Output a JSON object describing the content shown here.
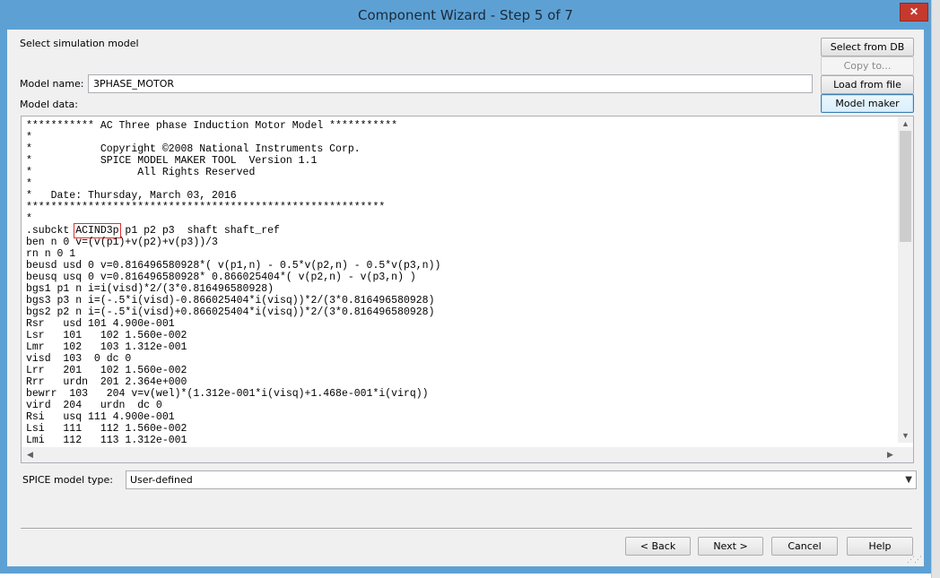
{
  "window": {
    "title": "Component Wizard - Step 5 of 7",
    "close_glyph": "✕"
  },
  "header": {
    "section_label": "Select simulation model"
  },
  "side_buttons": {
    "select_from_db": "Select from DB",
    "copy_to": "Copy to...",
    "load_from_file": "Load from file",
    "model_maker": "Model maker"
  },
  "model": {
    "name_label": "Model name:",
    "name_value": "3PHASE_MOTOR",
    "data_label": "Model data:",
    "highlighted_token": "ACIND3p",
    "lines": [
      "*********** AC Three phase Induction Motor Model ***********",
      "*",
      "*           Copyright ©2008 National Instruments Corp.",
      "*           SPICE MODEL MAKER TOOL  Version 1.1",
      "*                 All Rights Reserved",
      "*",
      "*   Date: Thursday, March 03, 2016",
      "**********************************************************",
      "*",
      ".subckt ACIND3p p1 p2 p3  shaft shaft_ref",
      "ben n 0 v=(v(p1)+v(p2)+v(p3))/3",
      "rn n 0 1",
      "beusd usd 0 v=0.816496580928*( v(p1,n) - 0.5*v(p2,n) - 0.5*v(p3,n))",
      "beusq usq 0 v=0.816496580928* 0.866025404*( v(p2,n) - v(p3,n) )",
      "bgs1 p1 n i=i(visd)*2/(3*0.816496580928)",
      "bgs3 p3 n i=(-.5*i(visd)-0.866025404*i(visq))*2/(3*0.816496580928)",
      "bgs2 p2 n i=(-.5*i(visd)+0.866025404*i(visq))*2/(3*0.816496580928)",
      "Rsr   usd 101 4.900e-001",
      "Lsr   101   102 1.560e-002",
      "Lmr   102   103 1.312e-001",
      "visd  103  0 dc 0",
      "Lrr   201   102 1.560e-002",
      "Rrr   urdn  201 2.364e+000",
      "bewrr  103   204 v=v(wel)*(1.312e-001*i(visq)+1.468e-001*i(virq))",
      "vird  204   urdn  dc 0",
      "Rsi   usq 111 4.900e-001",
      "Lsi   111   112 1.560e-002",
      "Lmi   112   113 1.312e-001"
    ]
  },
  "spice": {
    "label": "SPICE model type:",
    "value": "User-defined"
  },
  "footer": {
    "back": "< Back",
    "next": "Next >",
    "cancel": "Cancel",
    "help": "Help"
  },
  "icons": {
    "scroll_up": "▲",
    "scroll_down": "▼",
    "scroll_left": "◀",
    "scroll_right": "▶",
    "dropdown": "▼"
  }
}
